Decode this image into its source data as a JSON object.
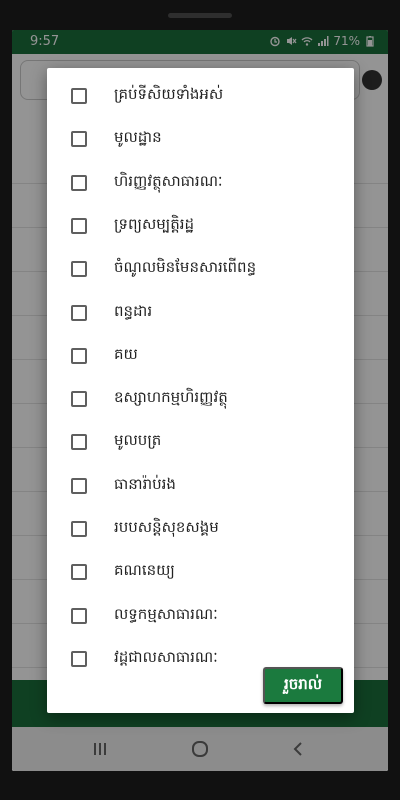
{
  "status_bar": {
    "time": "9:57",
    "battery": "71%",
    "icons": [
      "alarm-icon",
      "mute-icon",
      "wifi-icon",
      "signal-icon",
      "battery-icon"
    ]
  },
  "dialog": {
    "options": [
      {
        "label": "គ្រប់ទីសិយទាំងអស់",
        "checked": false
      },
      {
        "label": "មូលដ្ឋាន",
        "checked": false
      },
      {
        "label": "ហិរញ្ញវត្ថុសាធារណៈ",
        "checked": false
      },
      {
        "label": "ទ្រព្យសម្បត្តិរដ្ឋ",
        "checked": false
      },
      {
        "label": "ចំណូលមិនមែនសារពើពន្ធ",
        "checked": false
      },
      {
        "label": "ពន្ធដារ",
        "checked": false
      },
      {
        "label": "គយ",
        "checked": false
      },
      {
        "label": "ឧស្សាហកម្មហិរញ្ញវត្ថុ",
        "checked": false
      },
      {
        "label": "មូលបត្រ",
        "checked": false
      },
      {
        "label": "ធានារ៉ាប់រង",
        "checked": false
      },
      {
        "label": "របបសន្តិសុខសង្គម",
        "checked": false
      },
      {
        "label": "គណនេយ្យ",
        "checked": false
      },
      {
        "label": "លទ្ធកម្មសាធារណៈ",
        "checked": false
      },
      {
        "label": "វដ្តជាលសាធារណៈ",
        "checked": false
      }
    ],
    "done_label": "រួចរាល់"
  },
  "nav": {
    "recent_icon": "recent-apps-icon",
    "home_icon": "home-icon",
    "back_icon": "back-icon"
  },
  "colors": {
    "brand_green": "#1b6e3c",
    "button_green": "#1b7a3e"
  }
}
